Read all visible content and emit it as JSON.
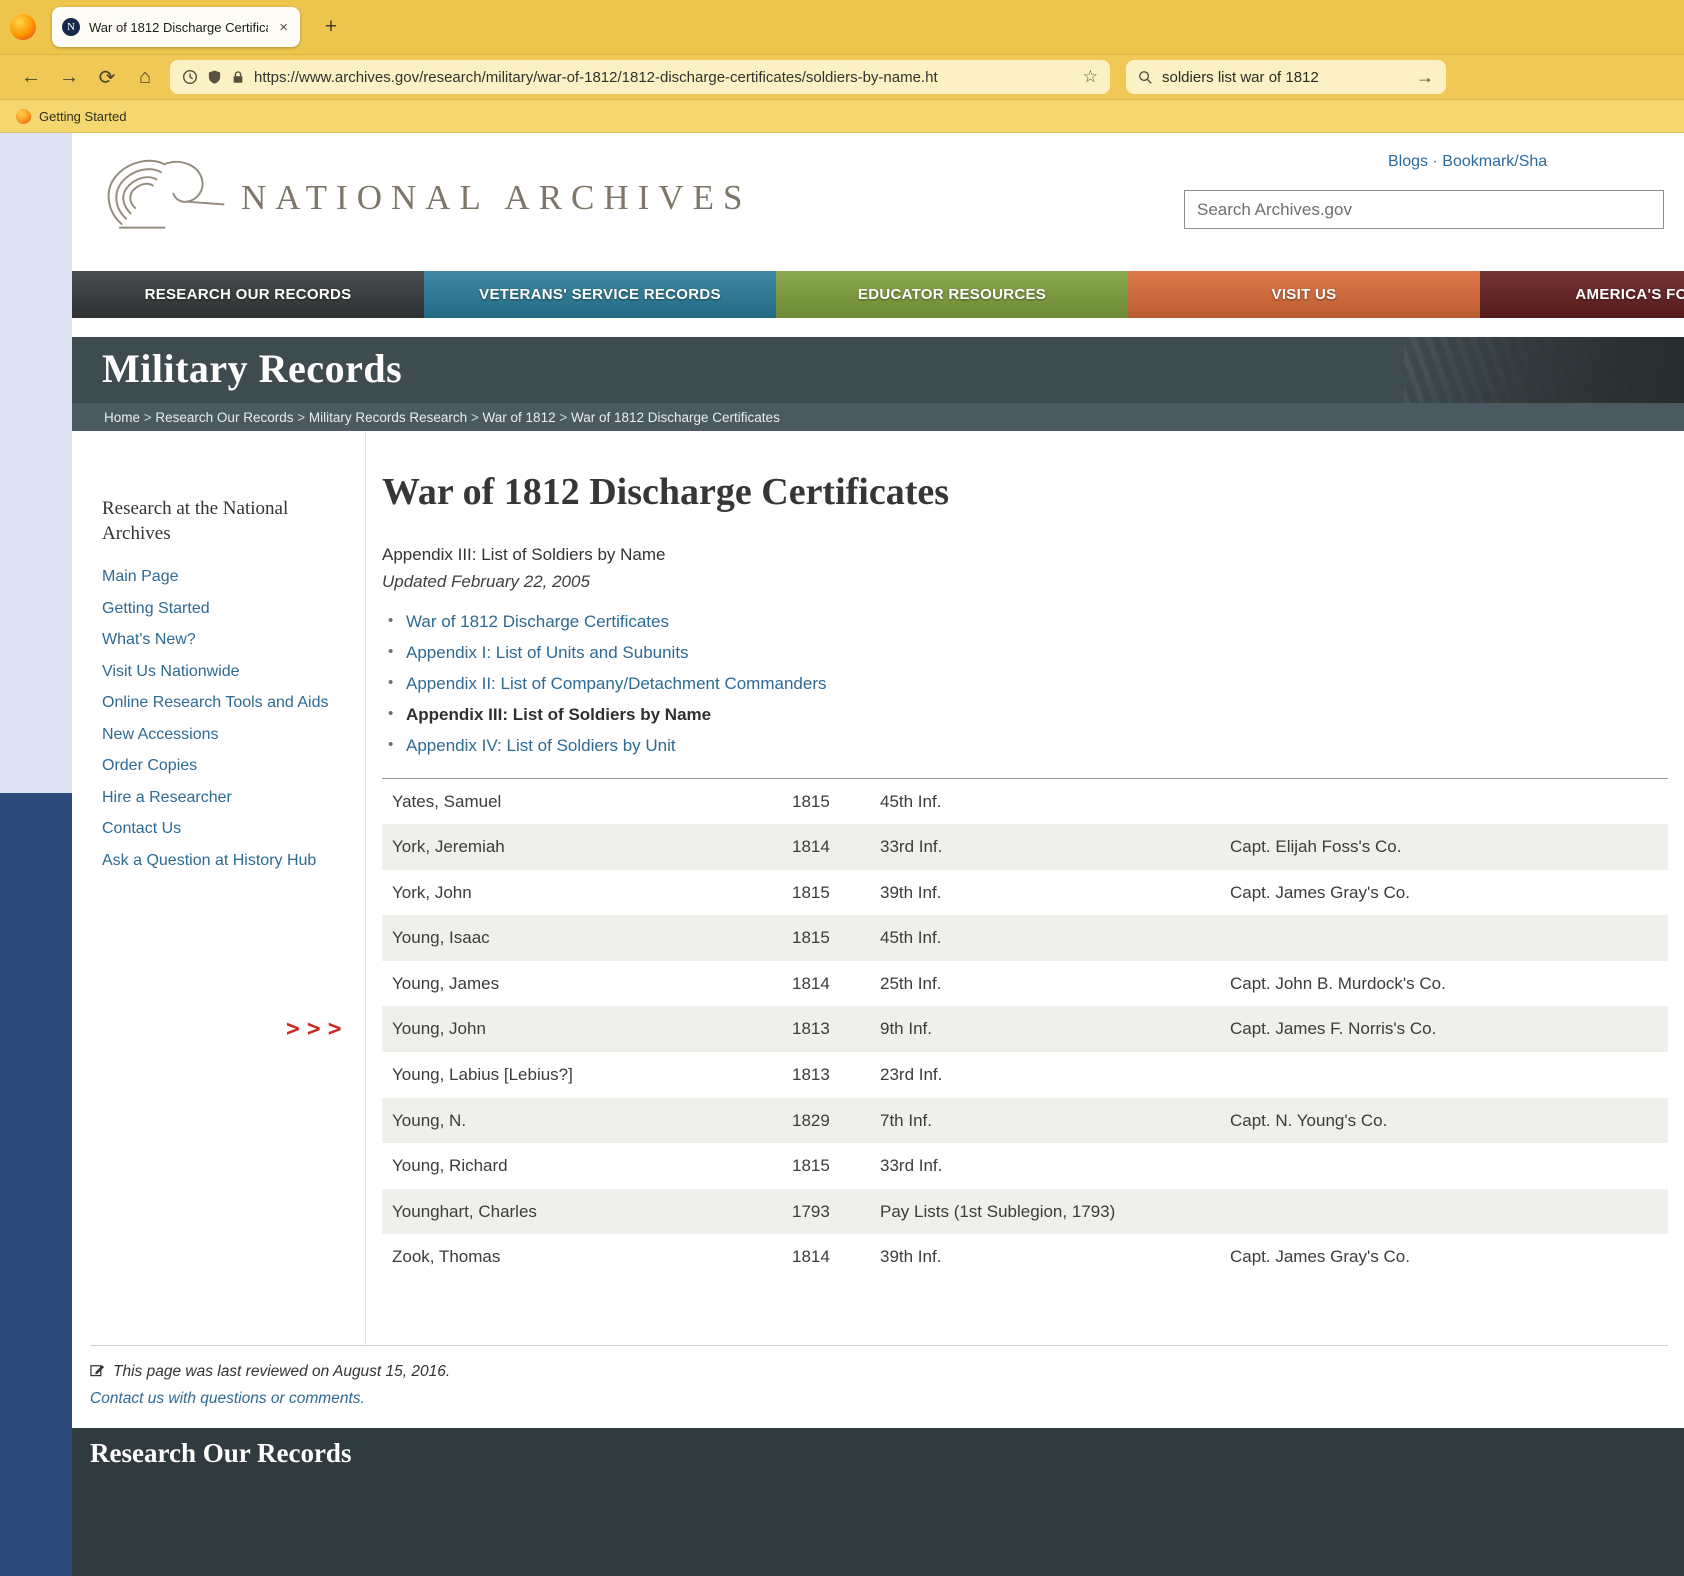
{
  "browser": {
    "tab_title": "War of 1812 Discharge Certifica",
    "tab_close": "×",
    "new_tab": "+",
    "back": "←",
    "forward": "→",
    "reload": "⟳",
    "home": "⌂",
    "url": "https://www.archives.gov/research/military/war-of-1812/1812-discharge-certificates/soldiers-by-name.ht",
    "bookmark_star": "☆",
    "search_query": "soldiers list war of 1812",
    "go_arrow": "→",
    "bookmark_label": "Getting Started",
    "favicon_letter": "N"
  },
  "site_header": {
    "logo_text": "NATIONAL ARCHIVES",
    "links": {
      "blogs": "Blogs",
      "dot": "·",
      "share": "Bookmark/Sha"
    },
    "search_placeholder": "Search Archives.gov"
  },
  "nav": {
    "items": [
      {
        "label": "RESEARCH OUR RECORDS",
        "color": "#35393a"
      },
      {
        "label": "VETERANS' SERVICE RECORDS",
        "color": "#2a7b99"
      },
      {
        "label": "EDUCATOR RESOURCES",
        "color": "#7fa03c"
      },
      {
        "label": "VISIT US",
        "color": "#d96b38"
      },
      {
        "label": "AMERICA'S FOUNDIN",
        "color": "#641e1e"
      }
    ]
  },
  "banner": {
    "title": "Military Records"
  },
  "breadcrumb": {
    "separator": ">",
    "items": [
      "Home",
      "Research Our Records",
      "Military Records Research",
      "War of 1812",
      "War of 1812 Discharge Certificates"
    ]
  },
  "sidebar": {
    "heading": "Research at the National Archives",
    "items": [
      "Main Page",
      "Getting Started",
      "What's New?",
      "Visit Us Nationwide",
      "Online Research Tools and Aids",
      "New Accessions",
      "Order Copies",
      "Hire a Researcher",
      "Contact Us",
      "Ask a Question at History Hub"
    ]
  },
  "main": {
    "title": "War of 1812 Discharge Certificates",
    "subtitle": "Appendix III: List of Soldiers by Name",
    "updated": "Updated February 22, 2005",
    "annotation": ">>>",
    "links": [
      {
        "label": "War of 1812 Discharge Certificates",
        "bold": false
      },
      {
        "label": "Appendix I: List of Units and Subunits",
        "bold": false
      },
      {
        "label": "Appendix II: List of Company/Detachment Commanders",
        "bold": false
      },
      {
        "label": "Appendix III: List of Soldiers by Name",
        "bold": true
      },
      {
        "label": "Appendix IV: List of Soldiers by Unit",
        "bold": false
      }
    ],
    "table": {
      "rows": [
        {
          "name": "Yates, Samuel",
          "year": "1815",
          "unit": "45th Inf.",
          "company": ""
        },
        {
          "name": "York, Jeremiah",
          "year": "1814",
          "unit": "33rd Inf.",
          "company": "Capt. Elijah Foss's Co."
        },
        {
          "name": "York, John",
          "year": "1815",
          "unit": "39th Inf.",
          "company": "Capt. James Gray's Co."
        },
        {
          "name": "Young, Isaac",
          "year": "1815",
          "unit": "45th Inf.",
          "company": ""
        },
        {
          "name": "Young, James",
          "year": "1814",
          "unit": "25th Inf.",
          "company": "Capt. John B. Murdock's Co."
        },
        {
          "name": "Young, John",
          "year": "1813",
          "unit": "9th Inf.",
          "company": "Capt. James F. Norris's Co.",
          "annotated": true
        },
        {
          "name": "Young, Labius [Lebius?]",
          "year": "1813",
          "unit": "23rd Inf.",
          "company": ""
        },
        {
          "name": "Young, N.",
          "year": "1829",
          "unit": "7th Inf.",
          "company": "Capt. N. Young's Co."
        },
        {
          "name": "Young, Richard",
          "year": "1815",
          "unit": "33rd Inf.",
          "company": ""
        },
        {
          "name": "Younghart, Charles",
          "year": "1793",
          "unit": "Pay Lists (1st Sublegion, 1793)",
          "company": ""
        },
        {
          "name": "Zook, Thomas",
          "year": "1814",
          "unit": "39th Inf.",
          "company": "Capt. James Gray's Co."
        }
      ]
    }
  },
  "footer": {
    "reviewed": "This page was last reviewed on August 15, 2016.",
    "contact": "Contact us with questions or comments."
  },
  "bottom_band": {
    "title": "Research Our Records"
  }
}
